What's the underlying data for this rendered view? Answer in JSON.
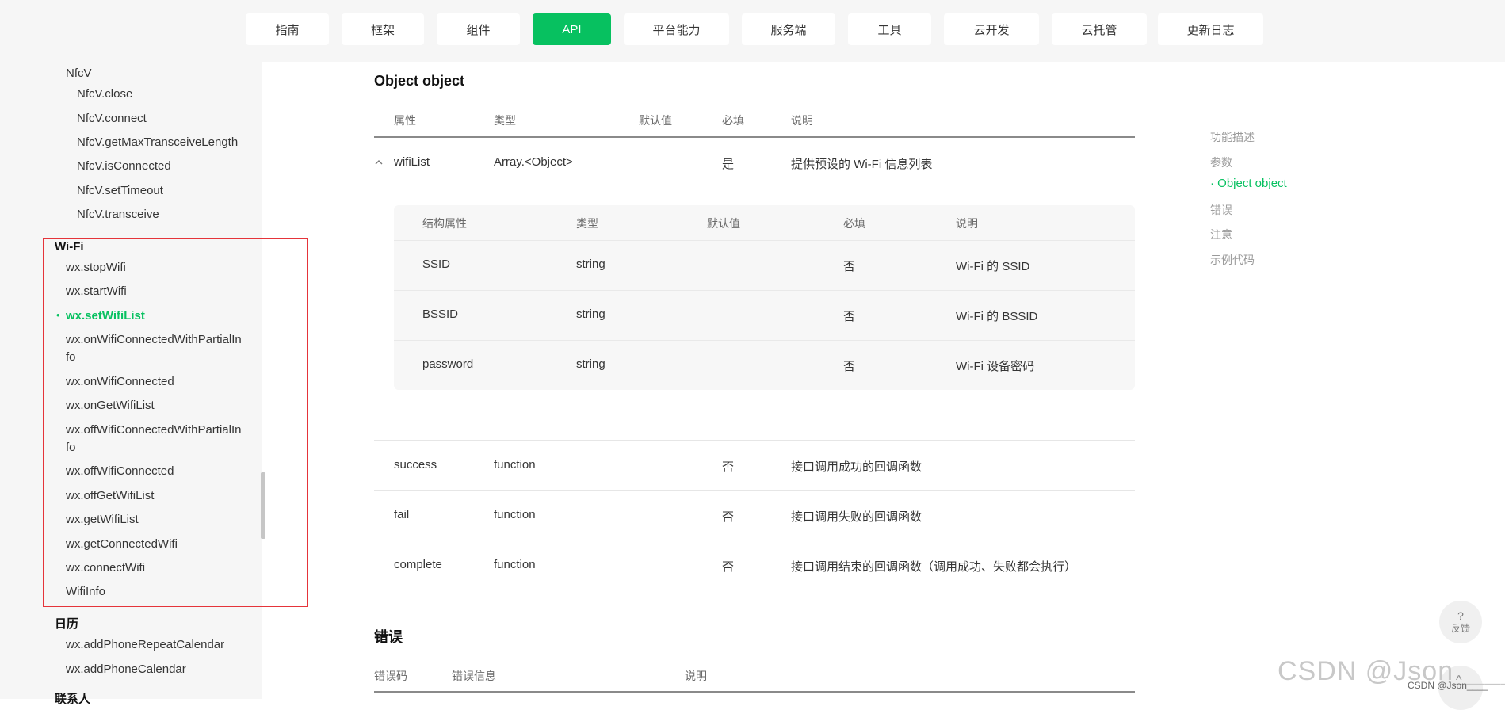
{
  "nav": {
    "items": [
      {
        "label": "指南",
        "active": false
      },
      {
        "label": "框架",
        "active": false
      },
      {
        "label": "组件",
        "active": false
      },
      {
        "label": "API",
        "active": true
      },
      {
        "label": "平台能力",
        "active": false
      },
      {
        "label": "服务端",
        "active": false
      },
      {
        "label": "工具",
        "active": false
      },
      {
        "label": "云开发",
        "active": false
      },
      {
        "label": "云托管",
        "active": false
      },
      {
        "label": "更新日志",
        "active": false
      }
    ]
  },
  "sidebar": {
    "nfcv_group": "NfcV",
    "nfcv_items": [
      "NfcV.close",
      "NfcV.connect",
      "NfcV.getMaxTransceiveLength",
      "NfcV.isConnected",
      "NfcV.setTimeout",
      "NfcV.transceive"
    ],
    "wifi_group": "Wi-Fi",
    "wifi_items": [
      "wx.stopWifi",
      "wx.startWifi",
      "wx.setWifiList",
      "wx.onWifiConnectedWithPartialInfo",
      "wx.onWifiConnected",
      "wx.onGetWifiList",
      "wx.offWifiConnectedWithPartialInfo",
      "wx.offWifiConnected",
      "wx.offGetWifiList",
      "wx.getWifiList",
      "wx.getConnectedWifi",
      "wx.connectWifi",
      "WifiInfo"
    ],
    "active_item": "wx.setWifiList",
    "calendar_group": "日历",
    "calendar_items": [
      "wx.addPhoneRepeatCalendar",
      "wx.addPhoneCalendar"
    ],
    "next_group": "联系人"
  },
  "main": {
    "title": "Object object",
    "headers": {
      "property": "属性",
      "type": "类型",
      "default": "默认值",
      "required": "必填",
      "desc": "说明"
    },
    "wifiList": {
      "name": "wifiList",
      "type": "Array.<Object>",
      "default": "",
      "required": "是",
      "desc": "提供预设的 Wi-Fi 信息列表"
    },
    "nested_headers": {
      "property": "结构属性",
      "type": "类型",
      "default": "默认值",
      "required": "必填",
      "desc": "说明"
    },
    "nested_rows": [
      {
        "name": "SSID",
        "type": "string",
        "default": "",
        "required": "否",
        "desc": "Wi-Fi 的 SSID"
      },
      {
        "name": "BSSID",
        "type": "string",
        "default": "",
        "required": "否",
        "desc": "Wi-Fi 的 BSSID"
      },
      {
        "name": "password",
        "type": "string",
        "default": "",
        "required": "否",
        "desc": "Wi-Fi 设备密码"
      }
    ],
    "rows": [
      {
        "name": "success",
        "type": "function",
        "default": "",
        "required": "否",
        "desc": "接口调用成功的回调函数"
      },
      {
        "name": "fail",
        "type": "function",
        "default": "",
        "required": "否",
        "desc": "接口调用失败的回调函数"
      },
      {
        "name": "complete",
        "type": "function",
        "default": "",
        "required": "否",
        "desc": "接口调用结束的回调函数（调用成功、失败都会执行）"
      }
    ],
    "errors_title": "错误",
    "errors_headers": {
      "code": "错误码",
      "info": "错误信息",
      "desc": "说明"
    }
  },
  "toc": {
    "items": [
      {
        "label": "功能描述",
        "active": false
      },
      {
        "label": "参数",
        "active": false
      },
      {
        "label": "· Object object",
        "active": true
      },
      {
        "label": "错误",
        "active": false
      },
      {
        "label": "注意",
        "active": false
      },
      {
        "label": "示例代码",
        "active": false
      }
    ]
  },
  "feedback": {
    "icon": "?",
    "label": "反馈"
  },
  "scroll_top_icon": "^",
  "watermark": {
    "big": "CSDN @Json____",
    "small": "CSDN @Json____"
  },
  "colors": {
    "accent": "#07c160",
    "highlight_box": "#e5343a"
  }
}
